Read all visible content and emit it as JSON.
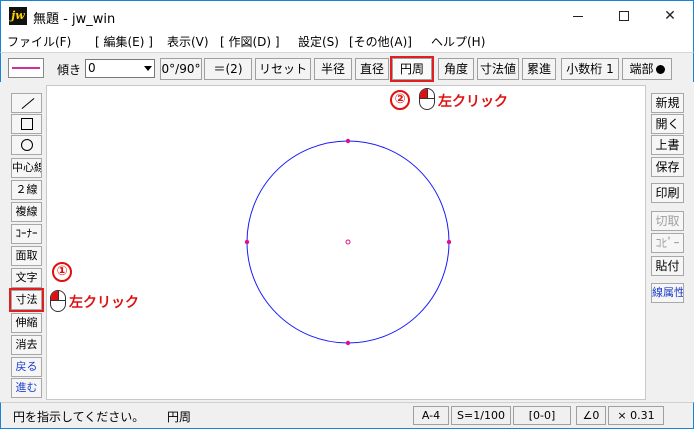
{
  "window": {
    "app_icon": "jw",
    "title": "無題 - jw_win",
    "minimize_icon": "minimize-icon",
    "maximize_icon": "maximize-icon",
    "close_icon": "close-icon"
  },
  "menu": [
    "ファイル(F)",
    "[ 編集(E) ]",
    "表示(V)",
    "[ 作図(D) ]",
    "設定(S)",
    "[その他(A)]",
    "ヘルプ(H)"
  ],
  "toolbar": {
    "angle_label": "傾き",
    "angle_value": "0",
    "buttons": [
      "0°/90°",
      "＝(2)",
      "リセット",
      "半径",
      "直径",
      "円周",
      "角度",
      "寸法値",
      "累進",
      "小数桁 1",
      "端部"
    ],
    "highlighted": "円周"
  },
  "left_tools": [
    "line",
    "rect",
    "circle",
    "中心線",
    "２線",
    "複線",
    "ｺｰﾅｰ",
    "面取",
    "文字",
    "寸法",
    "伸縮",
    "消去",
    "戻る",
    "進む"
  ],
  "right_tools": [
    "新規",
    "開く",
    "上書",
    "保存",
    "印刷",
    "切取",
    "ｺﾋﾟｰ",
    "貼付",
    "線属性"
  ],
  "annotations": {
    "step1": {
      "number": "①",
      "text": "左クリック"
    },
    "step2": {
      "number": "②",
      "text": "左クリック"
    }
  },
  "status": {
    "message": "円を指示してください。",
    "command": "円周",
    "paper": "A-4",
    "scale": "S=1/100",
    "layer": "[0-0]",
    "angle": "∠0",
    "zoom": "× 0.31"
  },
  "colors": {
    "circle_stroke": "#1a1aff",
    "point_color": "#e0108a",
    "highlight": "#e02020",
    "annotation": "#e01010"
  }
}
